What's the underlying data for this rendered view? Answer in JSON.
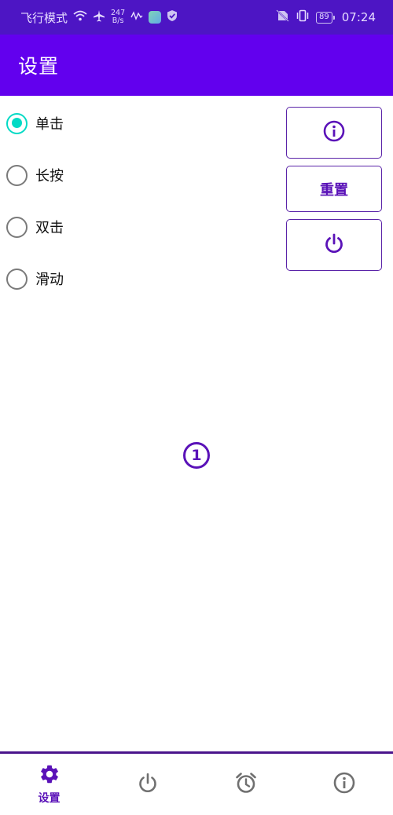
{
  "status_bar": {
    "carrier": "飞行模式",
    "net_speed_value": "247",
    "net_speed_unit": "B/s",
    "battery": "89",
    "time": "07:24"
  },
  "app_bar": {
    "title": "设置"
  },
  "radio_group": {
    "options": [
      {
        "label": "单击",
        "checked": true
      },
      {
        "label": "长按",
        "checked": false
      },
      {
        "label": "双击",
        "checked": false
      },
      {
        "label": "滑动",
        "checked": false
      }
    ]
  },
  "side_buttons": {
    "info_icon": "info-icon",
    "reset_label": "重置",
    "power_icon": "power-icon"
  },
  "page_indicator": {
    "value": "1"
  },
  "bottom_nav": {
    "items": [
      {
        "icon": "gear-icon",
        "label": "设置",
        "active": true
      },
      {
        "icon": "power-icon",
        "label": "",
        "active": false
      },
      {
        "icon": "alarm-clock-icon",
        "label": "",
        "active": false
      },
      {
        "icon": "info-icon",
        "label": "",
        "active": false
      }
    ]
  },
  "colors": {
    "status_bar": "#4d15c4",
    "app_bar": "#6200ee",
    "accent": "#03dac5",
    "primary_dark": "#5a12b8"
  }
}
